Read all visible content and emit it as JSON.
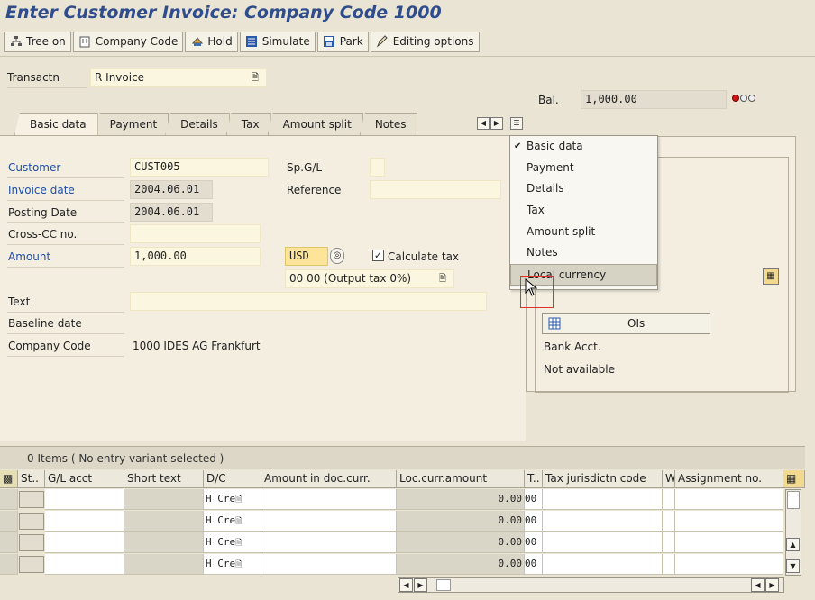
{
  "window": {
    "title": "Enter Customer Invoice: Company Code 1000"
  },
  "toolbar": {
    "tree_on": "Tree on",
    "company_code": "Company Code",
    "hold": "Hold",
    "simulate": "Simulate",
    "park": "Park",
    "editing_options": "Editing options"
  },
  "header": {
    "transaction_label": "Transactn",
    "transaction_value": "R Invoice",
    "balance_label": "Bal.",
    "balance_value": "1,000.00"
  },
  "tabs": [
    "Basic data",
    "Payment",
    "Details",
    "Tax",
    "Amount split",
    "Notes"
  ],
  "form": {
    "customer_label": "Customer",
    "customer_value": "CUST005",
    "spgl_label": "Sp.G/L",
    "invoice_date_label": "Invoice date",
    "invoice_date_value": "2004.06.01",
    "reference_label": "Reference",
    "posting_date_label": "Posting Date",
    "posting_date_value": "2004.06.01",
    "cross_cc_label": "Cross-CC no.",
    "amount_label": "Amount",
    "amount_value": "1,000.00",
    "currency_value": "USD",
    "calc_tax_label": "Calculate tax",
    "tax_code_value": "00 00 (Output tax 0%)",
    "text_label": "Text",
    "baseline_label": "Baseline date",
    "company_code_label": "Company Code",
    "company_code_value": "1000 IDES AG Frankfurt"
  },
  "tab_menu": {
    "items": [
      "Basic data",
      "Payment",
      "Details",
      "Tax",
      "Amount split",
      "Notes",
      "Local currency"
    ],
    "checked": "Basic data",
    "highlighted": "Local currency"
  },
  "right_panel": {
    "ois_label": "OIs",
    "bank_acct_label": "Bank Acct.",
    "not_available": "Not available"
  },
  "items_table": {
    "status": "0 Items ( No entry variant selected )",
    "columns": [
      "St..",
      "G/L acct",
      "Short text",
      "D/C",
      "Amount in doc.curr.",
      "Loc.curr.amount",
      "T..",
      "Tax jurisdictn code",
      "W..",
      "Assignment no."
    ],
    "rows": [
      {
        "dc": "H Cre",
        "loc_amount": "0.00",
        "tax": "00"
      },
      {
        "dc": "H Cre",
        "loc_amount": "0.00",
        "tax": "00"
      },
      {
        "dc": "H Cre",
        "loc_amount": "0.00",
        "tax": "00"
      },
      {
        "dc": "H Cre",
        "loc_amount": "0.00",
        "tax": "00"
      }
    ]
  },
  "colors": {
    "title": "#2f4d8c",
    "label_blue": "#1f4ea8",
    "input_bg": "#fbf6df",
    "background": "#e9e4d4"
  }
}
